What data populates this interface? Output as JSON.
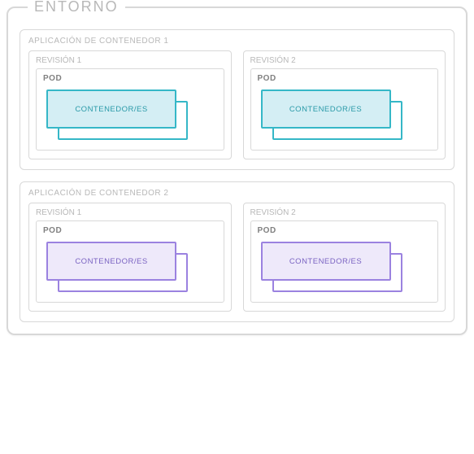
{
  "environment": {
    "title": "ENTORNO",
    "apps": [
      {
        "title": "APLICACIÓN DE CONTENEDOR 1",
        "color": "teal",
        "revisions": [
          {
            "title": "REVISIÓN 1",
            "pod_label": "POD",
            "container_label": "CONTENEDOR/ES"
          },
          {
            "title": "REVISIÓN 2",
            "pod_label": "POD",
            "container_label": "CONTENEDOR/ES"
          }
        ]
      },
      {
        "title": "APLICACIÓN DE CONTENEDOR 2",
        "color": "purple",
        "revisions": [
          {
            "title": "REVISIÓN 1",
            "pod_label": "POD",
            "container_label": "CONTENEDOR/ES"
          },
          {
            "title": "REVISIÓN 2",
            "pod_label": "POD",
            "container_label": "CONTENEDOR/ES"
          }
        ]
      }
    ]
  }
}
